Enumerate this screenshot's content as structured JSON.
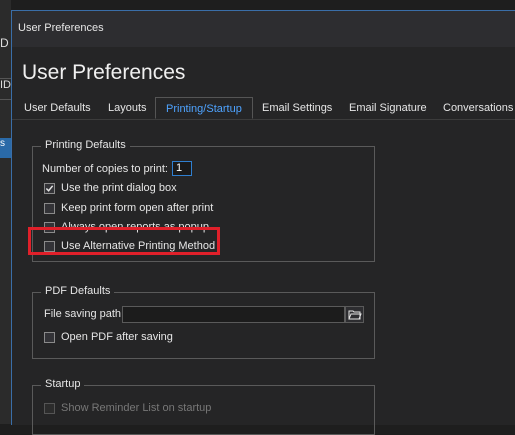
{
  "background_window": {
    "label_1": "D",
    "label_2": "ID",
    "label_3": "s"
  },
  "window": {
    "title": "User Preferences"
  },
  "header": {
    "title": "User Preferences"
  },
  "tabs": [
    {
      "label": "User Defaults",
      "active": false
    },
    {
      "label": "Layouts",
      "active": false
    },
    {
      "label": "Printing/Startup",
      "active": true
    },
    {
      "label": "Email Settings",
      "active": false
    },
    {
      "label": "Email Signature",
      "active": false
    },
    {
      "label": "Conversations",
      "active": false
    }
  ],
  "printing_defaults": {
    "legend": "Printing Defaults",
    "copies_label": "Number of copies to print:",
    "copies_value": "1",
    "use_print_dialog": {
      "label": "Use the print dialog box",
      "checked": true
    },
    "keep_form_open": {
      "label": "Keep print form open after print",
      "checked": false
    },
    "open_reports_popup": {
      "label": "Always open reports as popup",
      "checked": false
    },
    "alternative_printing": {
      "label": "Use Alternative Printing Method",
      "checked": false
    }
  },
  "pdf_defaults": {
    "legend": "PDF Defaults",
    "file_path_label": "File saving path:",
    "file_path_value": "",
    "open_pdf_after_saving": {
      "label": "Open PDF after saving",
      "checked": false
    }
  },
  "startup": {
    "legend": "Startup",
    "show_reminder_list": {
      "label": "Show Reminder List on startup",
      "checked": false,
      "disabled": true
    }
  },
  "colors": {
    "accent": "#4ea3ff",
    "highlight_box": "#e0202a",
    "background": "#252526"
  }
}
